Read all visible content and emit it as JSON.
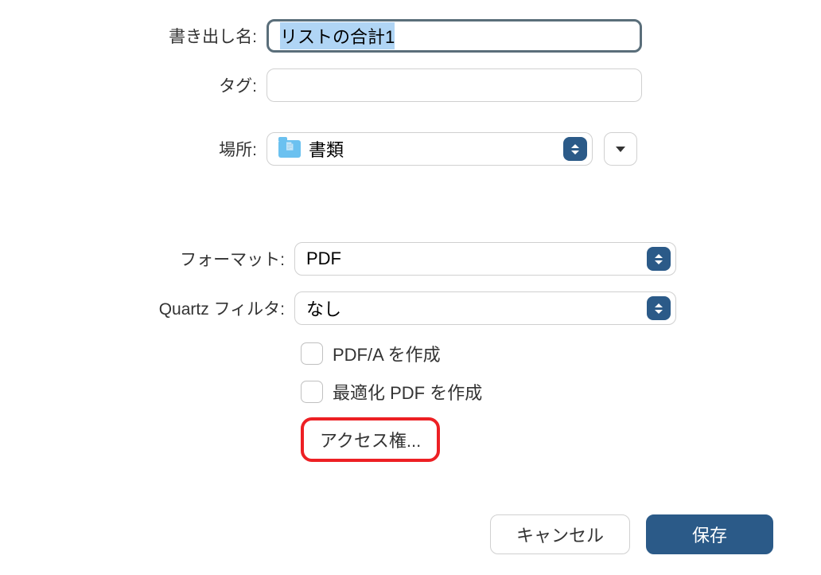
{
  "labels": {
    "export_name": "書き出し名:",
    "tags": "タグ:",
    "location": "場所:",
    "format": "フォーマット:",
    "quartz_filter": "Quartz フィルタ:",
    "pdfa_create": "PDF/A を作成",
    "optimized_pdf": "最適化 PDF を作成"
  },
  "values": {
    "export_name": "リストの合計1",
    "location": "書類",
    "format": "PDF",
    "quartz_filter": "なし"
  },
  "buttons": {
    "permissions": "アクセス権...",
    "cancel": "キャンセル",
    "save": "保存"
  }
}
